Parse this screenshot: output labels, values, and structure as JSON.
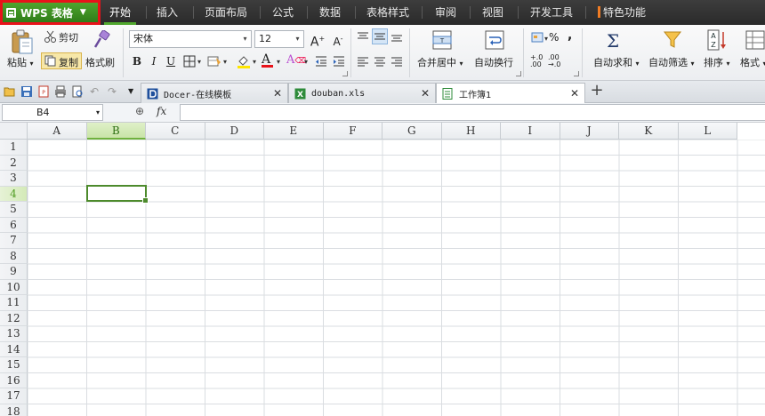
{
  "app": {
    "name": "WPS 表格",
    "accent": "#51a82e",
    "highlight_border": "#e8121a"
  },
  "menu": {
    "items": [
      "开始",
      "插入",
      "页面布局",
      "公式",
      "数据",
      "表格样式",
      "审阅",
      "视图",
      "开发工具",
      "特色功能"
    ],
    "active": "开始"
  },
  "ribbon": {
    "clipboard": {
      "paste": "粘贴",
      "cut": "剪切",
      "copy": "复制",
      "format_painter": "格式刷"
    },
    "font": {
      "name": "宋体",
      "size": "12",
      "bold": "B",
      "italic": "I",
      "underline": "U"
    },
    "align": {
      "merge_center": "合并居中",
      "wrap": "自动换行"
    },
    "number": {
      "percent": "%",
      "comma": ","
    },
    "editing": {
      "autosum": "自动求和",
      "autofilter": "自动筛选",
      "sort": "排序",
      "format": "格式"
    }
  },
  "tabs": [
    {
      "title": "Docer-在线模板",
      "icon": "docer-icon"
    },
    {
      "title": "douban.xls",
      "icon": "excel-file-icon"
    },
    {
      "title": "工作簿1",
      "icon": "workbook-icon",
      "active": true
    }
  ],
  "formula_bar": {
    "cell_ref": "B4",
    "fx": "fx",
    "value": ""
  },
  "sheet": {
    "columns": [
      "A",
      "B",
      "C",
      "D",
      "E",
      "F",
      "G",
      "H",
      "I",
      "J",
      "K",
      "L"
    ],
    "rows": [
      "1",
      "2",
      "3",
      "4",
      "5",
      "6",
      "7",
      "8",
      "9",
      "10",
      "11",
      "12",
      "13",
      "14",
      "15",
      "16",
      "17",
      "18"
    ],
    "selected_column": "B",
    "selected_row": "4"
  }
}
